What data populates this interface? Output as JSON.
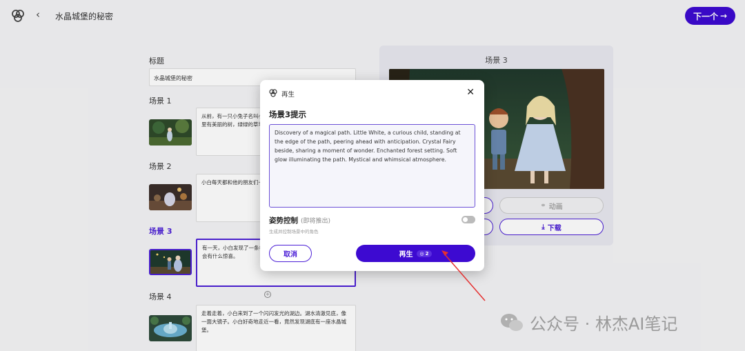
{
  "header": {
    "title": "水晶城堡的秘密",
    "back_icon": "chevron-left-icon",
    "next_label": "下一个",
    "next_arrow": "→",
    "accent": "#3d0ad1"
  },
  "form": {
    "title_label": "标题",
    "title_value": "水晶城堡的秘密",
    "scenes": [
      {
        "label": "场景 1",
        "text": "从前，有一只小兔子名叫小白，它住在一片美丽的森林里。森林里有美丽的树，绿绿的草地……"
      },
      {
        "label": "场景 2",
        "text": "小白每天都和他的朋友们一起在森林里玩耍，有小松鼠、小鸟。"
      },
      {
        "label": "场景 3",
        "text": "有一天，小白发现了一条神秘的小路，它好奇地想知道路的尽头会有什么惊喜。"
      },
      {
        "label": "场景 4",
        "text": "走着走着，小白来到了一个闪闪发光的湖边。湖水清澈见底，像一面大镜子。小白好奇地走近一看，竟然发现湖底有一座水晶城堡。"
      }
    ],
    "add_icon": "plus-circle-icon"
  },
  "preview": {
    "title": "场景 3",
    "animate_label": "动画",
    "download_label": "下载"
  },
  "modal": {
    "header_label": "再生",
    "close_label": "✕",
    "prompt_label": "场景3提示",
    "prompt_text": "Discovery of a magical path. Little White, a curious child, standing at the edge of the path, peering ahead with anticipation. Crystal Fairy beside, sharing a moment of wonder. Enchanted forest setting. Soft glow illuminating the path. Mystical and whimsical atmosphere.",
    "pose_label": "姿势控制",
    "pose_note": "(即将推出)",
    "pose_desc": "生成并控制场景中的角色",
    "pose_enabled": false,
    "cancel_label": "取消",
    "regen_label": "再生",
    "regen_credits": "2"
  },
  "watermark": {
    "text": "公众号 · 林杰AI笔记",
    "icon": "wechat-icon"
  }
}
